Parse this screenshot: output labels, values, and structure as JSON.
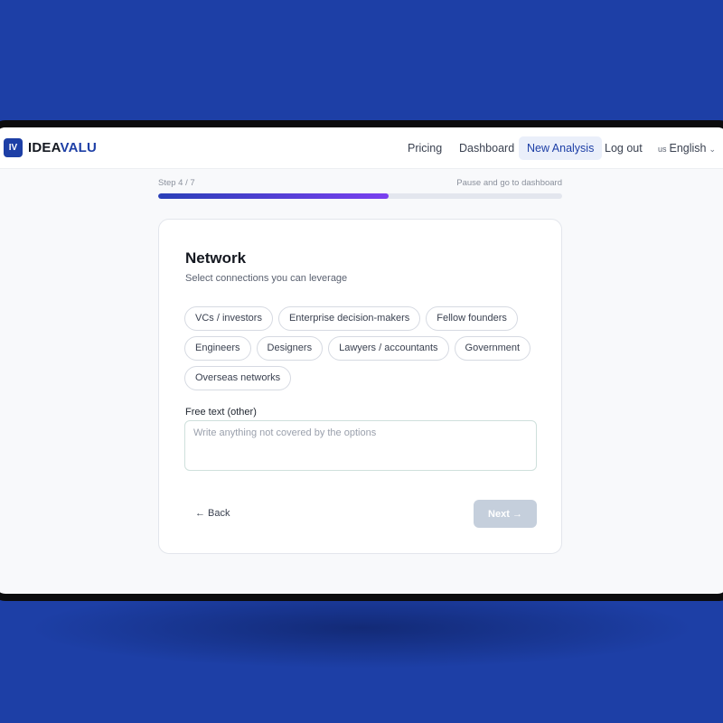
{
  "app": {
    "logo_mark": "IV",
    "logo_text_a": "IDEA",
    "logo_text_b": "VALU",
    "brand_color": "#1d3fa6"
  },
  "nav": {
    "pricing": "Pricing",
    "dashboard": "Dashboard",
    "new_analysis": "New Analysis",
    "logout": "Log out",
    "lang_code": "us",
    "lang_label": "English",
    "lang_chevron": "⌄"
  },
  "progress": {
    "step_text": "Step 4 / 7",
    "pause_text": "Pause and go to dashboard",
    "fraction": 0.571
  },
  "form": {
    "title": "Network",
    "subtitle": "Select connections you can leverage",
    "chips": [
      "VCs / investors",
      "Enterprise decision-makers",
      "Fellow founders",
      "Engineers",
      "Designers",
      "Lawyers / accountants",
      "Government",
      "Overseas networks"
    ],
    "free_text_label": "Free text (other)",
    "free_text_placeholder": "Write anything not covered by the options",
    "back_label": "← Back",
    "next_label": "Next →"
  }
}
